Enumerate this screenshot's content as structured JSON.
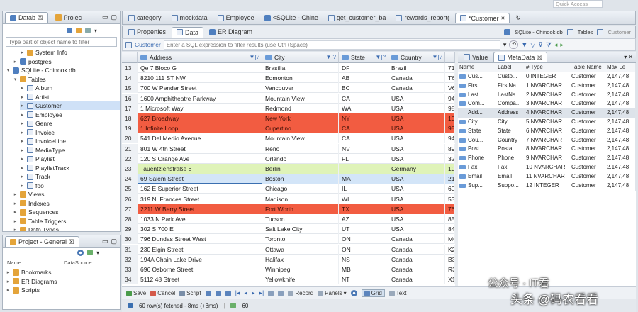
{
  "colors": {
    "accent": "#3b6fb0",
    "highlight_red": "#f25c41",
    "highlight_green": "#dff3b8",
    "selection": "#d3e5f8"
  },
  "quick_access": "Quick Access",
  "left_top": {
    "tabs": [
      "Datab ☒",
      "Projec"
    ],
    "filter_placeholder": "Type part of object name to filter",
    "tree": [
      {
        "label": "System Info",
        "level": 2,
        "icon": "fld"
      },
      {
        "label": "postgres",
        "level": 1,
        "icon": "db"
      },
      {
        "label": "SQLite - Chinook.db",
        "level": 0,
        "icon": "db"
      },
      {
        "label": "Tables",
        "level": 1,
        "icon": "fld"
      },
      {
        "label": "Album",
        "level": 2,
        "icon": "tbl"
      },
      {
        "label": "Artist",
        "level": 2,
        "icon": "tbl"
      },
      {
        "label": "Customer",
        "level": 2,
        "icon": "tbl",
        "selected": true
      },
      {
        "label": "Employee",
        "level": 2,
        "icon": "tbl"
      },
      {
        "label": "Genre",
        "level": 2,
        "icon": "tbl"
      },
      {
        "label": "Invoice",
        "level": 2,
        "icon": "tbl"
      },
      {
        "label": "InvoiceLine",
        "level": 2,
        "icon": "tbl"
      },
      {
        "label": "MediaType",
        "level": 2,
        "icon": "tbl"
      },
      {
        "label": "Playlist",
        "level": 2,
        "icon": "tbl"
      },
      {
        "label": "PlaylistTrack",
        "level": 2,
        "icon": "tbl"
      },
      {
        "label": "Track",
        "level": 2,
        "icon": "tbl"
      },
      {
        "label": "foo",
        "level": 2,
        "icon": "tbl"
      },
      {
        "label": "Views",
        "level": 1,
        "icon": "fld"
      },
      {
        "label": "Indexes",
        "level": 1,
        "icon": "fld"
      },
      {
        "label": "Sequences",
        "level": 1,
        "icon": "fld"
      },
      {
        "label": "Table Triggers",
        "level": 1,
        "icon": "fld"
      },
      {
        "label": "Data Types",
        "level": 1,
        "icon": "fld"
      }
    ]
  },
  "project": {
    "title": "Project - General ☒",
    "col1": "Name",
    "col2": "DataSource",
    "items": [
      "Bookmarks",
      "ER Diagrams",
      "Scripts"
    ]
  },
  "editor_tabs": [
    "category",
    "mockdata",
    "Employee",
    "<SQLite - Chine",
    "get_customer_ba",
    "rewards_report(",
    "*Customer"
  ],
  "sub_tabs": [
    "Properties",
    "Data",
    "ER Diagram"
  ],
  "right_info": [
    "SQLite - Chinook.db",
    "Tables",
    "Customer"
  ],
  "filter_bar": {
    "table": "Customer",
    "placeholder": "Enter a SQL expression to filter results (use Ctrl+Space)"
  },
  "columns": [
    "Address",
    "City",
    "State",
    "Country"
  ],
  "rows": [
    {
      "n": "13",
      "a": "Qe 7 Bloco G",
      "c": "Brasília",
      "s": "DF",
      "co": "Brazil",
      "x": "71"
    },
    {
      "n": "14",
      "a": "8210 111 ST NW",
      "c": "Edmonton",
      "s": "AB",
      "co": "Canada",
      "x": "T6"
    },
    {
      "n": "15",
      "a": "700 W Pender Street",
      "c": "Vancouver",
      "s": "BC",
      "co": "Canada",
      "x": "V6"
    },
    {
      "n": "16",
      "a": "1600 Amphitheatre Parkway",
      "c": "Mountain View",
      "s": "CA",
      "co": "USA",
      "x": "94"
    },
    {
      "n": "17",
      "a": "1 Microsoft Way",
      "c": "Redmond",
      "s": "WA",
      "co": "USA",
      "x": "98"
    },
    {
      "n": "18",
      "a": "627 Broadway",
      "c": "New York",
      "s": "NY",
      "co": "USA",
      "x": "10",
      "h": "red"
    },
    {
      "n": "19",
      "a": "1 Infinite Loop",
      "c": "Cupertino",
      "s": "CA",
      "co": "USA",
      "x": "95",
      "h": "red"
    },
    {
      "n": "20",
      "a": "541 Del Medio Avenue",
      "c": "Mountain View",
      "s": "CA",
      "co": "USA",
      "x": "94"
    },
    {
      "n": "21",
      "a": "801 W 4th Street",
      "c": "Reno",
      "s": "NV",
      "co": "USA",
      "x": "89"
    },
    {
      "n": "22",
      "a": "120 S Orange Ave",
      "c": "Orlando",
      "s": "FL",
      "co": "USA",
      "x": "32"
    },
    {
      "n": "23",
      "a": "Tauentzienstraße 8",
      "c": "Berlin",
      "s": "",
      "co": "Germany",
      "x": "10",
      "h": "green"
    },
    {
      "n": "24",
      "a": "69 Salem Street",
      "c": "Boston",
      "s": "MA",
      "co": "USA",
      "x": "21",
      "h": "blue"
    },
    {
      "n": "25",
      "a": "162 E Superior Street",
      "c": "Chicago",
      "s": "IL",
      "co": "USA",
      "x": "60"
    },
    {
      "n": "26",
      "a": "319 N. Frances Street",
      "c": "Madison",
      "s": "WI",
      "co": "USA",
      "x": "53"
    },
    {
      "n": "27",
      "a": "2211 W Berry Street",
      "c": "Fort Worth",
      "s": "TX",
      "co": "USA",
      "x": "76",
      "h": "red"
    },
    {
      "n": "28",
      "a": "1033 N Park Ave",
      "c": "Tucson",
      "s": "AZ",
      "co": "USA",
      "x": "85"
    },
    {
      "n": "29",
      "a": "302 S 700 E",
      "c": "Salt Lake City",
      "s": "UT",
      "co": "USA",
      "x": "84"
    },
    {
      "n": "30",
      "a": "796 Dundas Street West",
      "c": "Toronto",
      "s": "ON",
      "co": "Canada",
      "x": "M6"
    },
    {
      "n": "31",
      "a": "230 Elgin Street",
      "c": "Ottawa",
      "s": "ON",
      "co": "Canada",
      "x": "K2"
    },
    {
      "n": "32",
      "a": "194A Chain Lake Drive",
      "c": "Halifax",
      "s": "NS",
      "co": "Canada",
      "x": "B3"
    },
    {
      "n": "33",
      "a": "696 Osborne Street",
      "c": "Winnipeg",
      "s": "MB",
      "co": "Canada",
      "x": "R3"
    },
    {
      "n": "34",
      "a": "5112 48 Street",
      "c": "Yellowknife",
      "s": "NT",
      "co": "Canada",
      "x": "X1"
    }
  ],
  "panel_tabs": [
    "Value",
    "MetaData ☒"
  ],
  "meta_cols": [
    "Name",
    "Label",
    "# Type",
    "Table Name",
    "Max Le"
  ],
  "meta_rows": [
    [
      "Cus...",
      "Custo...",
      "0 INTEGER",
      "Customer",
      "2,147,48"
    ],
    [
      "First...",
      "FirstNa...",
      "1 NVARCHAR",
      "Customer",
      "2,147,48"
    ],
    [
      "Last...",
      "LastNa...",
      "2 NVARCHAR",
      "Customer",
      "2,147,48"
    ],
    [
      "Com...",
      "Compa...",
      "3 NVARCHAR",
      "Customer",
      "2,147,48"
    ],
    [
      "Add...",
      "Address",
      "4 NVARCHAR",
      "Customer",
      "2,147,48"
    ],
    [
      "City",
      "City",
      "5 NVARCHAR",
      "Customer",
      "2,147,48"
    ],
    [
      "State",
      "State",
      "6 NVARCHAR",
      "Customer",
      "2,147,48"
    ],
    [
      "Cou...",
      "Country",
      "7 NVARCHAR",
      "Customer",
      "2,147,48"
    ],
    [
      "Post...",
      "Postal...",
      "8 NVARCHAR",
      "Customer",
      "2,147,48"
    ],
    [
      "Phone",
      "Phone",
      "9 NVARCHAR",
      "Customer",
      "2,147,48"
    ],
    [
      "Fax",
      "Fax",
      "10 NVARCHAR",
      "Customer",
      "2,147,48"
    ],
    [
      "Email",
      "Email",
      "11 NVARCHAR",
      "Customer",
      "2,147,48"
    ],
    [
      "Sup...",
      "Suppo...",
      "12 INTEGER",
      "Customer",
      "2,147,48"
    ]
  ],
  "toolbar": {
    "save": "Save",
    "cancel": "Cancel",
    "script": "Script",
    "record": "Record",
    "panels": "Panels",
    "grid": "Grid",
    "text": "Text"
  },
  "status": {
    "rows_fetched": "60 row(s) fetched - 8ms (+8ms)",
    "sixty": "60"
  },
  "watermark": {
    "gzh": "公众号 · IT君",
    "toutiao": "头条 @码农看看"
  }
}
